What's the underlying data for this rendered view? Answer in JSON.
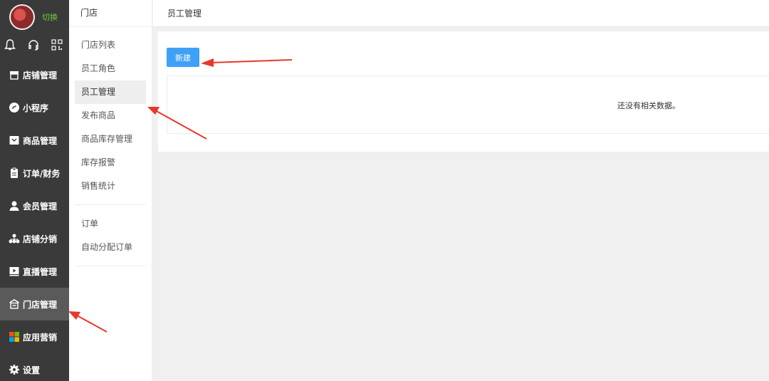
{
  "nav": {
    "switch_label": "切换",
    "items": [
      {
        "label": "店铺管理",
        "icon": "store-icon"
      },
      {
        "label": "小程序",
        "icon": "mini-program-icon"
      },
      {
        "label": "商品管理",
        "icon": "product-icon"
      },
      {
        "label": "订单/财务",
        "icon": "clipboard-icon"
      },
      {
        "label": "会员管理",
        "icon": "user-icon"
      },
      {
        "label": "店铺分销",
        "icon": "distribution-icon"
      },
      {
        "label": "直播管理",
        "icon": "live-icon"
      },
      {
        "label": "门店管理",
        "icon": "shop-icon"
      },
      {
        "label": "应用营销",
        "icon": "apps-icon"
      },
      {
        "label": "设置",
        "icon": "gear-icon"
      }
    ]
  },
  "sub": {
    "title": "门店",
    "group1": [
      "门店列表",
      "员工角色",
      "员工管理",
      "发布商品",
      "商品库存管理",
      "库存报警",
      "销售统计"
    ],
    "group2": [
      "订单",
      "自动分配订单"
    ]
  },
  "header": {
    "title": "员工管理"
  },
  "main": {
    "new_button": "新建",
    "empty_text": "还没有相关数据。"
  },
  "colors": {
    "accent": "#3fa0f7",
    "sidebar": "#3a3a3a",
    "switch": "#6fce3d",
    "arrow": "#e8382c"
  }
}
